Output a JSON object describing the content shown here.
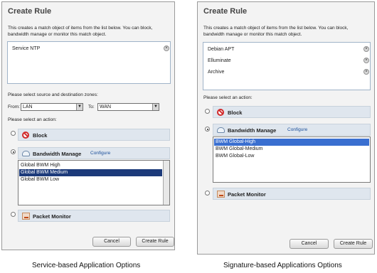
{
  "left": {
    "title": "Create Rule",
    "description": "This creates a match object of items from the list below. You can block, bandwidth manage or monitor this match object.",
    "list_items": [
      "Service NTP"
    ],
    "zones_label": "Please select source and destination zones:",
    "from_label": "From:",
    "from_value": "LAN",
    "to_label": "To:",
    "to_value": "WAN",
    "action_label": "Please select an action:",
    "block_label": "Block",
    "bwm_label": "Bandwidth Manage",
    "configure_label": "Configure",
    "bwm_options": [
      "Global BWM High",
      "Global BWM Medium",
      "Global BWM Low"
    ],
    "selected_option": "Global BWM Medium",
    "pm_label": "Packet Monitor",
    "cancel": "Cancel",
    "create": "Create Rule",
    "caption": "Service-based Application Options"
  },
  "right": {
    "title": "Create Rule",
    "description": "This creates a match object of items from the list below. You can block, bandwidth manage or monitor this match object.",
    "list_items": [
      "Debian APT",
      "Elluminate",
      "Archive"
    ],
    "action_label": "Please select an action:",
    "block_label": "Block",
    "bwm_label": "Bandwidth Manage",
    "configure_label": "Configure",
    "bwm_options": [
      "BWM Global-High",
      "BWM Global-Medium",
      "BWM Global-Low"
    ],
    "selected_option": "BWM Global-High",
    "pm_label": "Packet Monitor",
    "cancel": "Cancel",
    "create": "Create Rule",
    "caption": "Signature-based Applications Options"
  }
}
